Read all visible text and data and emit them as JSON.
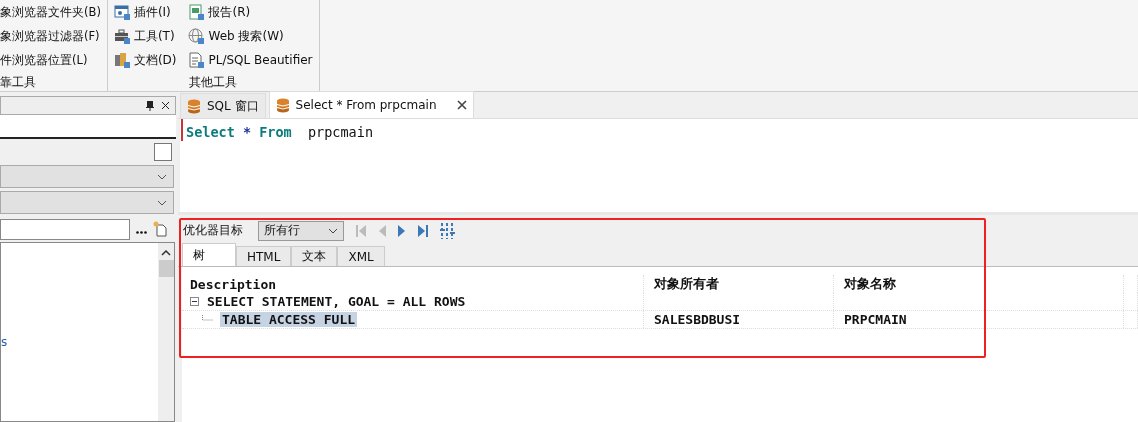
{
  "ribbon": {
    "groups": [
      {
        "label": "靠工具",
        "items": [
          {
            "label": "象浏览器文件夹(B)"
          },
          {
            "label": "象浏览器过滤器(F)"
          },
          {
            "label": "件浏览器位置(L)"
          }
        ]
      },
      {
        "label": "其他工具",
        "items": [
          {
            "label": "插件(I)",
            "kind": "plugin"
          },
          {
            "label": "工具(T)",
            "kind": "tools"
          },
          {
            "label": "文档(D)",
            "kind": "docs"
          },
          {
            "label": "报告(R)",
            "kind": "report"
          },
          {
            "label": "Web 搜索(W)",
            "kind": "web"
          },
          {
            "label": "PL/SQL Beautifier",
            "kind": "beautifier"
          }
        ]
      }
    ]
  },
  "left_panel": {
    "checkbox": {
      "checked": false
    },
    "list_items": [
      "s"
    ]
  },
  "editor": {
    "tabs": [
      {
        "label": "SQL 窗口",
        "selected": false,
        "closable": false
      },
      {
        "label": "Select * From prpcmain",
        "selected": true,
        "closable": true
      }
    ],
    "sql": [
      {
        "text": "Select",
        "kind": "keyword"
      },
      {
        "text": "*",
        "kind": "operator"
      },
      {
        "text": "From",
        "kind": "keyword"
      },
      {
        "text": "prpcmain",
        "kind": "identifier"
      }
    ]
  },
  "plan": {
    "optimizer_label": "优化器目标",
    "optimizer_value": "所有行",
    "tabs": [
      {
        "label": "树",
        "selected": true
      },
      {
        "label": "HTML",
        "selected": false
      },
      {
        "label": "文本",
        "selected": false
      },
      {
        "label": "XML",
        "selected": false
      }
    ],
    "columns": [
      "Description",
      "对象所有者",
      "对象名称"
    ],
    "rows": [
      {
        "description": "SELECT STATEMENT, GOAL = ALL ROWS",
        "expanded": true,
        "selected": false,
        "children": [
          {
            "description": "TABLE ACCESS FULL",
            "owner": "SALESBDBUSI",
            "name": "PRPCMAIN",
            "selected": true
          }
        ]
      }
    ]
  }
}
